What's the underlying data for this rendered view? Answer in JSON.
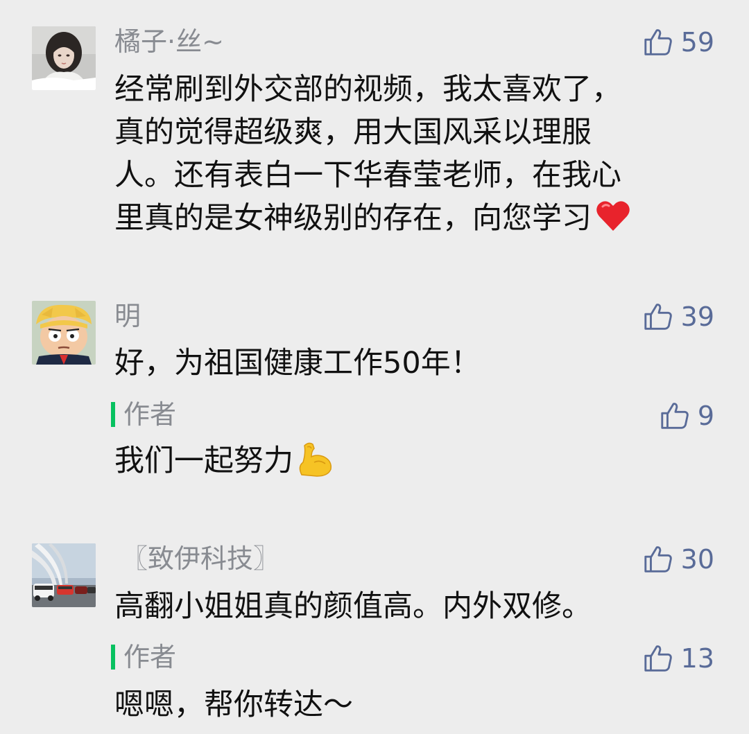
{
  "comments": [
    {
      "nickname": "橘子·丝~",
      "likes": "59",
      "avatar_icon": "avatar-woman-photo",
      "content_lines": [
        "经常刷到外交部的视频，我太喜欢了，",
        "真的觉得超级爽，用大国风采以理服",
        "人。还有表白一下华春莹老师，在我心",
        "里真的是女神级别的存在，向您学习"
      ],
      "content_emoji": "red-heart-emoji"
    },
    {
      "nickname": "明",
      "likes": "39",
      "avatar_icon": "avatar-cartoon-man",
      "content_lines": [
        "好，为祖国健康工作50年！"
      ],
      "reply": {
        "label": "作者",
        "likes": "9",
        "text": "我们一起努力",
        "emoji": "flexed-biceps-emoji"
      }
    },
    {
      "nickname": "〖致伊科技〗",
      "likes": "30",
      "avatar_icon": "avatar-cars-photo",
      "content_lines": [
        "高翻小姐姐真的颜值高。内外双修。"
      ],
      "reply": {
        "label": "作者",
        "likes": "13",
        "text": "嗯嗯，帮你转达～"
      }
    }
  ],
  "colors": {
    "background": "#ededed",
    "nickname": "#888b91",
    "like": "#596b98",
    "author_bar": "#07c160",
    "text": "#111111"
  }
}
